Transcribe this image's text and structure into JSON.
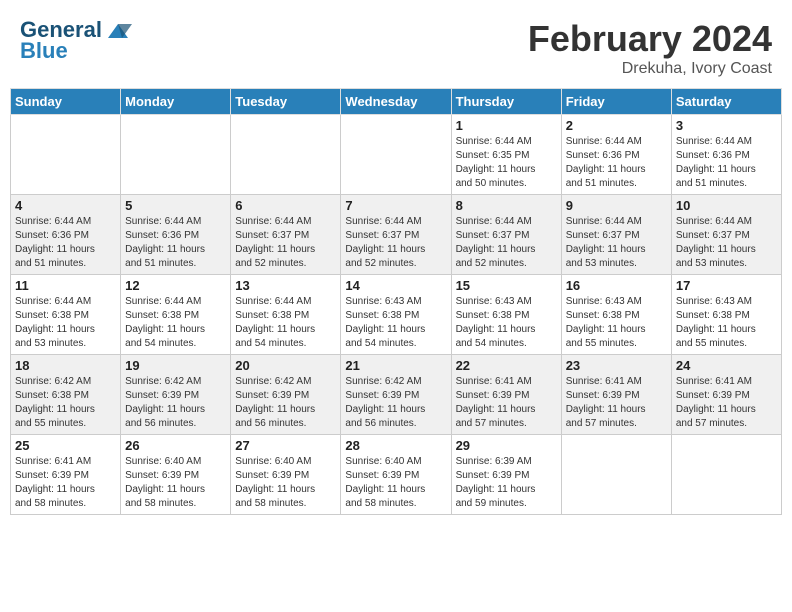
{
  "header": {
    "logo_line1": "General",
    "logo_line2": "Blue",
    "title": "February 2024",
    "subtitle": "Drekuha, Ivory Coast"
  },
  "days_of_week": [
    "Sunday",
    "Monday",
    "Tuesday",
    "Wednesday",
    "Thursday",
    "Friday",
    "Saturday"
  ],
  "weeks": [
    [
      {
        "day": "",
        "info": ""
      },
      {
        "day": "",
        "info": ""
      },
      {
        "day": "",
        "info": ""
      },
      {
        "day": "",
        "info": ""
      },
      {
        "day": "1",
        "info": "Sunrise: 6:44 AM\nSunset: 6:35 PM\nDaylight: 11 hours\nand 50 minutes."
      },
      {
        "day": "2",
        "info": "Sunrise: 6:44 AM\nSunset: 6:36 PM\nDaylight: 11 hours\nand 51 minutes."
      },
      {
        "day": "3",
        "info": "Sunrise: 6:44 AM\nSunset: 6:36 PM\nDaylight: 11 hours\nand 51 minutes."
      }
    ],
    [
      {
        "day": "4",
        "info": "Sunrise: 6:44 AM\nSunset: 6:36 PM\nDaylight: 11 hours\nand 51 minutes."
      },
      {
        "day": "5",
        "info": "Sunrise: 6:44 AM\nSunset: 6:36 PM\nDaylight: 11 hours\nand 51 minutes."
      },
      {
        "day": "6",
        "info": "Sunrise: 6:44 AM\nSunset: 6:37 PM\nDaylight: 11 hours\nand 52 minutes."
      },
      {
        "day": "7",
        "info": "Sunrise: 6:44 AM\nSunset: 6:37 PM\nDaylight: 11 hours\nand 52 minutes."
      },
      {
        "day": "8",
        "info": "Sunrise: 6:44 AM\nSunset: 6:37 PM\nDaylight: 11 hours\nand 52 minutes."
      },
      {
        "day": "9",
        "info": "Sunrise: 6:44 AM\nSunset: 6:37 PM\nDaylight: 11 hours\nand 53 minutes."
      },
      {
        "day": "10",
        "info": "Sunrise: 6:44 AM\nSunset: 6:37 PM\nDaylight: 11 hours\nand 53 minutes."
      }
    ],
    [
      {
        "day": "11",
        "info": "Sunrise: 6:44 AM\nSunset: 6:38 PM\nDaylight: 11 hours\nand 53 minutes."
      },
      {
        "day": "12",
        "info": "Sunrise: 6:44 AM\nSunset: 6:38 PM\nDaylight: 11 hours\nand 54 minutes."
      },
      {
        "day": "13",
        "info": "Sunrise: 6:44 AM\nSunset: 6:38 PM\nDaylight: 11 hours\nand 54 minutes."
      },
      {
        "day": "14",
        "info": "Sunrise: 6:43 AM\nSunset: 6:38 PM\nDaylight: 11 hours\nand 54 minutes."
      },
      {
        "day": "15",
        "info": "Sunrise: 6:43 AM\nSunset: 6:38 PM\nDaylight: 11 hours\nand 54 minutes."
      },
      {
        "day": "16",
        "info": "Sunrise: 6:43 AM\nSunset: 6:38 PM\nDaylight: 11 hours\nand 55 minutes."
      },
      {
        "day": "17",
        "info": "Sunrise: 6:43 AM\nSunset: 6:38 PM\nDaylight: 11 hours\nand 55 minutes."
      }
    ],
    [
      {
        "day": "18",
        "info": "Sunrise: 6:42 AM\nSunset: 6:38 PM\nDaylight: 11 hours\nand 55 minutes."
      },
      {
        "day": "19",
        "info": "Sunrise: 6:42 AM\nSunset: 6:39 PM\nDaylight: 11 hours\nand 56 minutes."
      },
      {
        "day": "20",
        "info": "Sunrise: 6:42 AM\nSunset: 6:39 PM\nDaylight: 11 hours\nand 56 minutes."
      },
      {
        "day": "21",
        "info": "Sunrise: 6:42 AM\nSunset: 6:39 PM\nDaylight: 11 hours\nand 56 minutes."
      },
      {
        "day": "22",
        "info": "Sunrise: 6:41 AM\nSunset: 6:39 PM\nDaylight: 11 hours\nand 57 minutes."
      },
      {
        "day": "23",
        "info": "Sunrise: 6:41 AM\nSunset: 6:39 PM\nDaylight: 11 hours\nand 57 minutes."
      },
      {
        "day": "24",
        "info": "Sunrise: 6:41 AM\nSunset: 6:39 PM\nDaylight: 11 hours\nand 57 minutes."
      }
    ],
    [
      {
        "day": "25",
        "info": "Sunrise: 6:41 AM\nSunset: 6:39 PM\nDaylight: 11 hours\nand 58 minutes."
      },
      {
        "day": "26",
        "info": "Sunrise: 6:40 AM\nSunset: 6:39 PM\nDaylight: 11 hours\nand 58 minutes."
      },
      {
        "day": "27",
        "info": "Sunrise: 6:40 AM\nSunset: 6:39 PM\nDaylight: 11 hours\nand 58 minutes."
      },
      {
        "day": "28",
        "info": "Sunrise: 6:40 AM\nSunset: 6:39 PM\nDaylight: 11 hours\nand 58 minutes."
      },
      {
        "day": "29",
        "info": "Sunrise: 6:39 AM\nSunset: 6:39 PM\nDaylight: 11 hours\nand 59 minutes."
      },
      {
        "day": "",
        "info": ""
      },
      {
        "day": "",
        "info": ""
      }
    ]
  ]
}
